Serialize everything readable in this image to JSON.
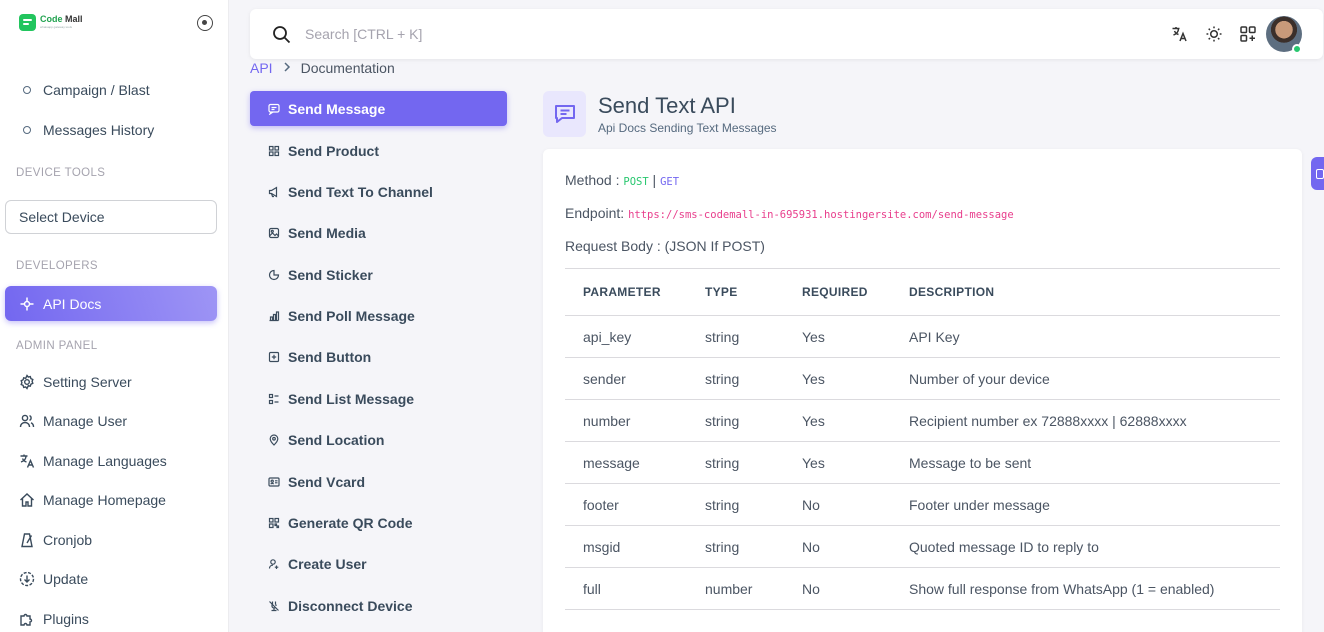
{
  "brand": {
    "name_part1": "Code ",
    "name_part2": "Mall",
    "tagline": "whatsapp gateway tools"
  },
  "sidebar": {
    "items_top": [
      {
        "label": "Campaign / Blast",
        "icon": "circle-icon"
      },
      {
        "label": "Messages History",
        "icon": "circle-icon"
      }
    ],
    "section_device_tools": "DEVICE TOOLS",
    "select_device": "Select Device",
    "section_developers": "DEVELOPERS",
    "api_docs": "API Docs",
    "section_admin": "ADMIN PANEL",
    "admin_items": [
      {
        "label": "Setting Server",
        "icon": "gear-icon"
      },
      {
        "label": "Manage User",
        "icon": "users-icon"
      },
      {
        "label": "Manage Languages",
        "icon": "translate-icon"
      },
      {
        "label": "Manage Homepage",
        "icon": "home-icon"
      },
      {
        "label": "Cronjob",
        "icon": "metronome-icon"
      },
      {
        "label": "Update",
        "icon": "update-icon"
      },
      {
        "label": "Plugins",
        "icon": "plugin-icon"
      }
    ]
  },
  "topbar": {
    "search_placeholder": "Search [CTRL + K]"
  },
  "breadcrumb": {
    "parent": "API",
    "current": "Documentation"
  },
  "docnav": [
    {
      "label": "Send Message",
      "icon": "message-icon",
      "active": true
    },
    {
      "label": "Send Product",
      "icon": "product-icon"
    },
    {
      "label": "Send Text To Channel",
      "icon": "megaphone-icon"
    },
    {
      "label": "Send Media",
      "icon": "image-icon"
    },
    {
      "label": "Send Sticker",
      "icon": "sticker-icon"
    },
    {
      "label": "Send Poll Message",
      "icon": "poll-icon"
    },
    {
      "label": "Send Button",
      "icon": "button-icon"
    },
    {
      "label": "Send List Message",
      "icon": "list-icon"
    },
    {
      "label": "Send Location",
      "icon": "location-icon"
    },
    {
      "label": "Send Vcard",
      "icon": "vcard-icon"
    },
    {
      "label": "Generate QR Code",
      "icon": "qr-icon"
    },
    {
      "label": "Create User",
      "icon": "user-plus-icon"
    },
    {
      "label": "Disconnect Device",
      "icon": "disconnect-icon"
    }
  ],
  "content": {
    "title": "Send Text API",
    "subtitle": "Api Docs Sending Text Messages",
    "method_label": "Method : ",
    "method_post": "POST",
    "method_sep": " | ",
    "method_get": "GET",
    "endpoint_label": "Endpoint: ",
    "endpoint_url": "https://sms-codemall-in-695931.hostingersite.com/send-message",
    "request_body": "Request Body : (JSON If POST)",
    "table": {
      "headers": [
        "PARAMETER",
        "TYPE",
        "REQUIRED",
        "DESCRIPTION"
      ],
      "rows": [
        [
          "api_key",
          "string",
          "Yes",
          "API Key"
        ],
        [
          "sender",
          "string",
          "Yes",
          "Number of your device"
        ],
        [
          "number",
          "string",
          "Yes",
          "Recipient number ex 72888xxxx | 62888xxxx"
        ],
        [
          "message",
          "string",
          "Yes",
          "Message to be sent"
        ],
        [
          "footer",
          "string",
          "No",
          "Footer under message"
        ],
        [
          "msgid",
          "string",
          "No",
          "Quoted message ID to reply to"
        ],
        [
          "full",
          "number",
          "No",
          "Show full response from WhatsApp (1 = enabled)"
        ]
      ]
    }
  },
  "colors": {
    "accent": "#7367f0",
    "post": "#28c76f",
    "endpoint": "#e83e8c",
    "brand": "#22c55e"
  }
}
